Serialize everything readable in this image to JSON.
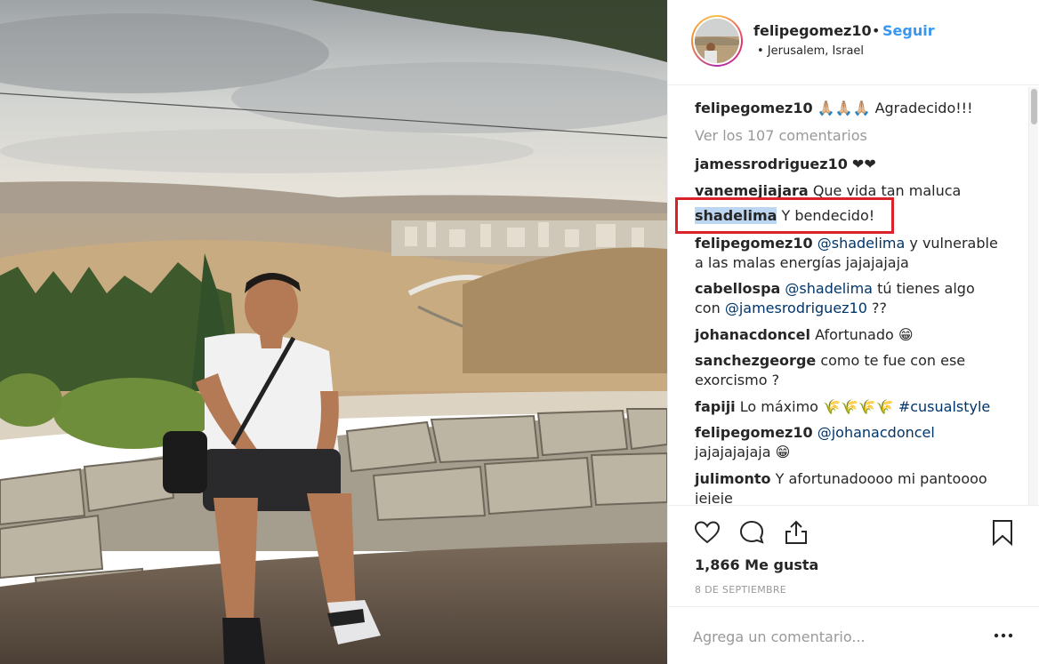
{
  "post": {
    "author": "felipegomez10",
    "follow_label": "Seguir",
    "dot": "•",
    "location": "• Jerusalem, Israel"
  },
  "caption": {
    "user": "felipegomez10",
    "text": " 🙏🏼🙏🏼🙏🏼 Agradecido!!!"
  },
  "view_comments": "Ver los 107 comentarios",
  "comments": [
    {
      "user": "jamessrodriguez10",
      "text": " ❤❤"
    },
    {
      "user": "vanemejiajara",
      "text": " Que vida tan maluca"
    },
    {
      "user": "shadelima",
      "text": " Y bendecido!"
    },
    {
      "user": "felipegomez10",
      "mention": "@shadelima",
      "text": " y vulnerable",
      "text2": "a las malas energías jajajajaja"
    },
    {
      "user": "cabellospa",
      "mention": "@shadelima",
      "text": " tú tienes algo",
      "text2_pre": "con ",
      "mention2": "@jamesrodriguez10",
      "text2_post": " ??"
    },
    {
      "user": "johanacdoncel",
      "text": " Afortunado 😁"
    },
    {
      "user": "sanchezgeorge",
      "text": " como te fue con ese",
      "text2": "exorcismo ?"
    },
    {
      "user": "fapiji",
      "text": " Lo máximo 🌾🌾🌾🌾 ",
      "hashtag": "#cusualstyle"
    },
    {
      "user": "felipegomez10",
      "mention": "@johanacdoncel",
      "text2": "jajajajajaja 😁"
    },
    {
      "user": "julimonto",
      "text": " Y afortunadoooo mi pantoooo",
      "text2": "jejeje"
    }
  ],
  "likes": "1,866 Me gusta",
  "date": "8 DE SEPTIEMBRE",
  "add_comment": {
    "placeholder": "Agrega un comentario..."
  },
  "icons": [
    "heart-icon",
    "comment-icon",
    "share-icon",
    "bookmark-icon",
    "more-icon"
  ],
  "colors": {
    "link": "#3897f0",
    "mention": "#003569",
    "highlight_box": "#d9232a",
    "muted": "#999999"
  }
}
